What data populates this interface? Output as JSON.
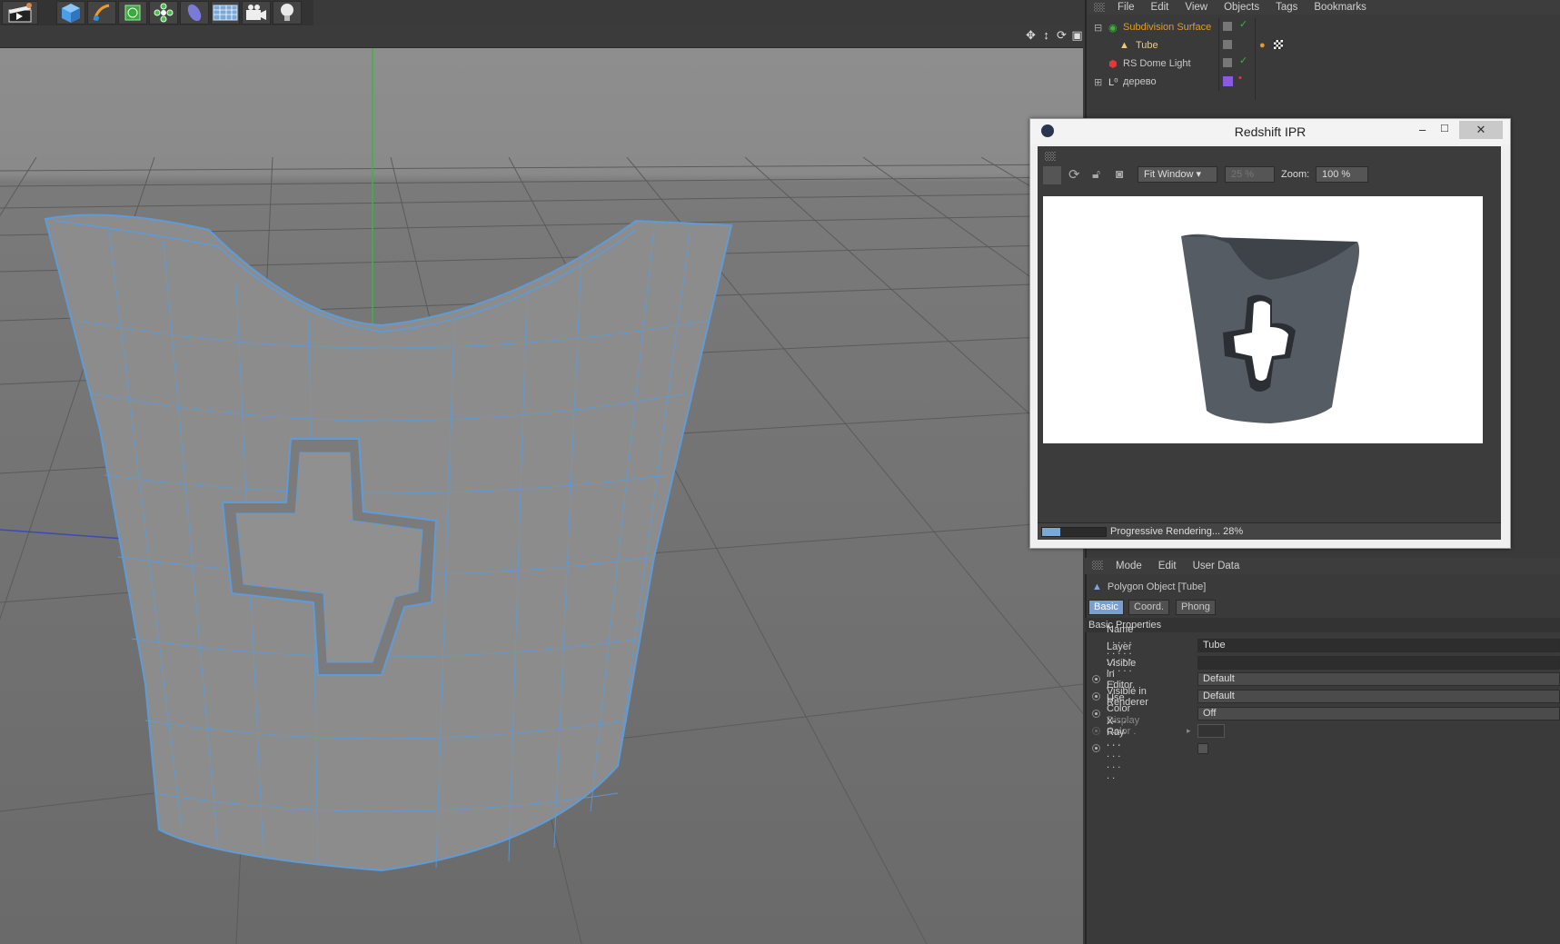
{
  "toolbar": {
    "icons": [
      "clapper-icon",
      "cube-icon",
      "pen-icon",
      "subdivision-icon",
      "cloner-icon",
      "deformer-icon",
      "floor-icon",
      "camera-icon",
      "light-bulb-icon"
    ]
  },
  "object_manager": {
    "menu": [
      "File",
      "Edit",
      "View",
      "Objects",
      "Tags",
      "Bookmarks"
    ],
    "items": [
      {
        "name": "Subdivision Surface",
        "color": "#e39b2b"
      },
      {
        "name": "Tube",
        "color": "#f4c96b"
      },
      {
        "name": "RS Dome Light",
        "color": "#d0d0d0"
      },
      {
        "name": "дерево",
        "color": "#d0d0d0"
      }
    ]
  },
  "ipr": {
    "title": "Redshift IPR",
    "fit_window": "Fit Window",
    "percent": "25 %",
    "zoom_label": "Zoom:",
    "zoom_value": "100 %",
    "status": "Progressive Rendering... 28%",
    "progress": 0.28
  },
  "attributes": {
    "menu": [
      "Mode",
      "Edit",
      "User Data"
    ],
    "object_title": "Polygon Object [Tube]",
    "tabs": [
      "Basic",
      "Coord.",
      "Phong"
    ],
    "section": "Basic Properties",
    "fields": [
      {
        "label": "Name . . . . . . . . . . . .",
        "value": "Tube"
      },
      {
        "label": "Layer . . . . . . . . . . . .",
        "value": ""
      },
      {
        "label": "Visible in Editor. . .",
        "value": "Default"
      },
      {
        "label": "Visible in Renderer",
        "value": "Default"
      },
      {
        "label": "Use Color . . . . . . . .",
        "value": "Off"
      },
      {
        "label": "Display Color . . . .",
        "value": ""
      },
      {
        "label": "X-Ray . . . . . . . . . . .",
        "value": ""
      }
    ]
  },
  "colors": {
    "selection_blue": "#5e9bd8",
    "accent_orange": "#e39b2b",
    "axis_green": "#3bb53b"
  }
}
